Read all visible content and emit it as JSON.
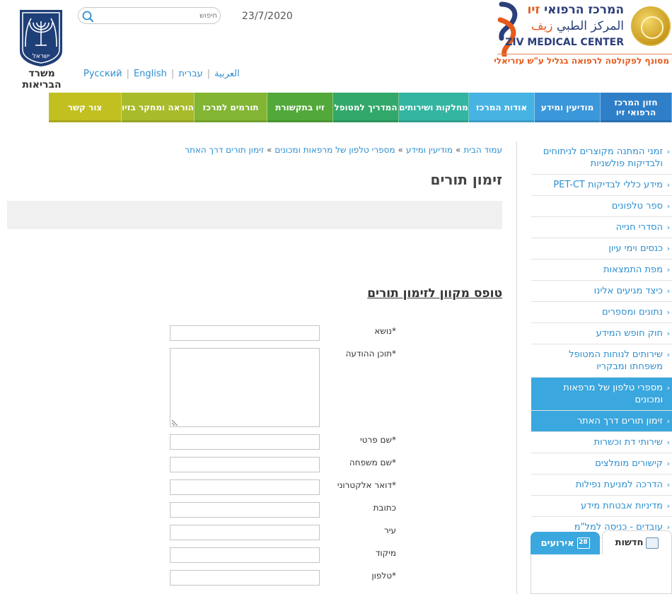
{
  "header": {
    "logo_he_main": "המרכז הרפואי",
    "logo_he_accent": "זיו",
    "logo_ar_main": "المركز الطبي",
    "logo_ar_accent": "زيف",
    "logo_en": "ZIV MEDICAL CENTER",
    "logo_tagline": "מסונף לפקולטה לרפואה בגליל ע\"ש עזריאלי",
    "date": "23/7/2020",
    "search_placeholder": "חיפוש",
    "languages": [
      "עברית",
      "العربية",
      "English",
      "Русский"
    ],
    "moh_emblem_text": "ישראל",
    "moh_label": "משרד הבריאות"
  },
  "colors": {
    "brand_blue": "#2b3f7a",
    "brand_orange": "#e55a1c",
    "link_blue": "#2e8fcf",
    "active_blue": "#3aa7de"
  },
  "nav": [
    {
      "label": "חזון המרכז\nהרפואי זיו",
      "color": "#2f7fc8"
    },
    {
      "label": "מודיעין ומידע",
      "color": "#3a97da"
    },
    {
      "label": "אודות המרכז",
      "color": "#46b3e3"
    },
    {
      "label": "מחלקות ושירותים",
      "color": "#33b5a2"
    },
    {
      "label": "המדריך למטופל",
      "color": "#32a86a"
    },
    {
      "label": "זיו בתקשורת",
      "color": "#52a93a"
    },
    {
      "label": "תורמים למרכז",
      "color": "#82b534"
    },
    {
      "label": "הוראה ומחקר בזיו",
      "color": "#a8bb2a"
    },
    {
      "label": "צור קשר",
      "color": "#c2c021"
    }
  ],
  "sidebar": {
    "items": [
      {
        "label": "זמני המתנה מקוצרים לניתוחים ולבדיקות פולשניות",
        "active": false
      },
      {
        "label": "מידע כללי לבדיקות PET-CT",
        "active": false
      },
      {
        "label": "ספר טלפונים",
        "active": false
      },
      {
        "label": "הסדרי חנייה",
        "active": false
      },
      {
        "label": "כנסים וימי עיון",
        "active": false
      },
      {
        "label": "מפת התמצאות",
        "active": false
      },
      {
        "label": "כיצד מגיעים אלינו",
        "active": false
      },
      {
        "label": "נתונים ומספרים",
        "active": false
      },
      {
        "label": "חוק חופש המידע",
        "active": false
      },
      {
        "label": "שירותים לנוחות המטופל משפחתו ומבקריו",
        "active": false
      },
      {
        "label": "מספרי טלפון של מרפאות ומכונים",
        "active": true
      },
      {
        "label": "זימון תורים דרך האתר",
        "active": true
      },
      {
        "label": "שירותי דת וכשרות",
        "active": false
      },
      {
        "label": "קישורים מומלצים",
        "active": false
      },
      {
        "label": "הדרכה למניעת נפילות",
        "active": false
      },
      {
        "label": "מדיניות אבטחת מידע",
        "active": false
      },
      {
        "label": "עובדים - כניסה למל\"מ",
        "active": false
      }
    ],
    "tab_news": "חדשות",
    "tab_events": "אירועים",
    "calendar_day": "28"
  },
  "breadcrumb": {
    "items": [
      "עמוד הבית",
      "מודיעין ומידע",
      "מספרי טלפון של מרפאות ומכונים",
      "זימון תורים דרך האתר"
    ],
    "separator": "»"
  },
  "main": {
    "title": "זימון תורים",
    "form_title": "טופס מקוון לזימון תורים",
    "fields": [
      {
        "label": "*נושא",
        "value": ""
      },
      {
        "label": "*תוכן ההודעה",
        "value": ""
      },
      {
        "label": "*שם פרטי",
        "value": ""
      },
      {
        "label": "*שם משפחה",
        "value": ""
      },
      {
        "label": "*דואר אלקטרוני",
        "value": ""
      },
      {
        "label": "כתובת",
        "value": ""
      },
      {
        "label": "עיר",
        "value": ""
      },
      {
        "label": "מיקוד",
        "value": ""
      },
      {
        "label": "*טלפון",
        "value": ""
      }
    ]
  }
}
